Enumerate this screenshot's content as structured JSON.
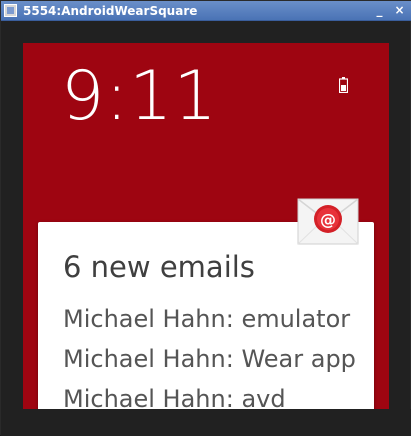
{
  "window": {
    "title": "5554:AndroidWearSquare",
    "minimize_label": "_",
    "close_label": "×",
    "titlebar_color": "#4a73b5"
  },
  "watch": {
    "background_color": "#9e0511",
    "time": "9:11",
    "battery_icon": "battery-charging-icon",
    "notification": {
      "app_icon": "email-envelope-icon",
      "title": "6 new emails",
      "lines": [
        "Michael Hahn: emulator",
        "Michael Hahn: Wear app",
        "Michael Hahn: avd"
      ]
    }
  }
}
